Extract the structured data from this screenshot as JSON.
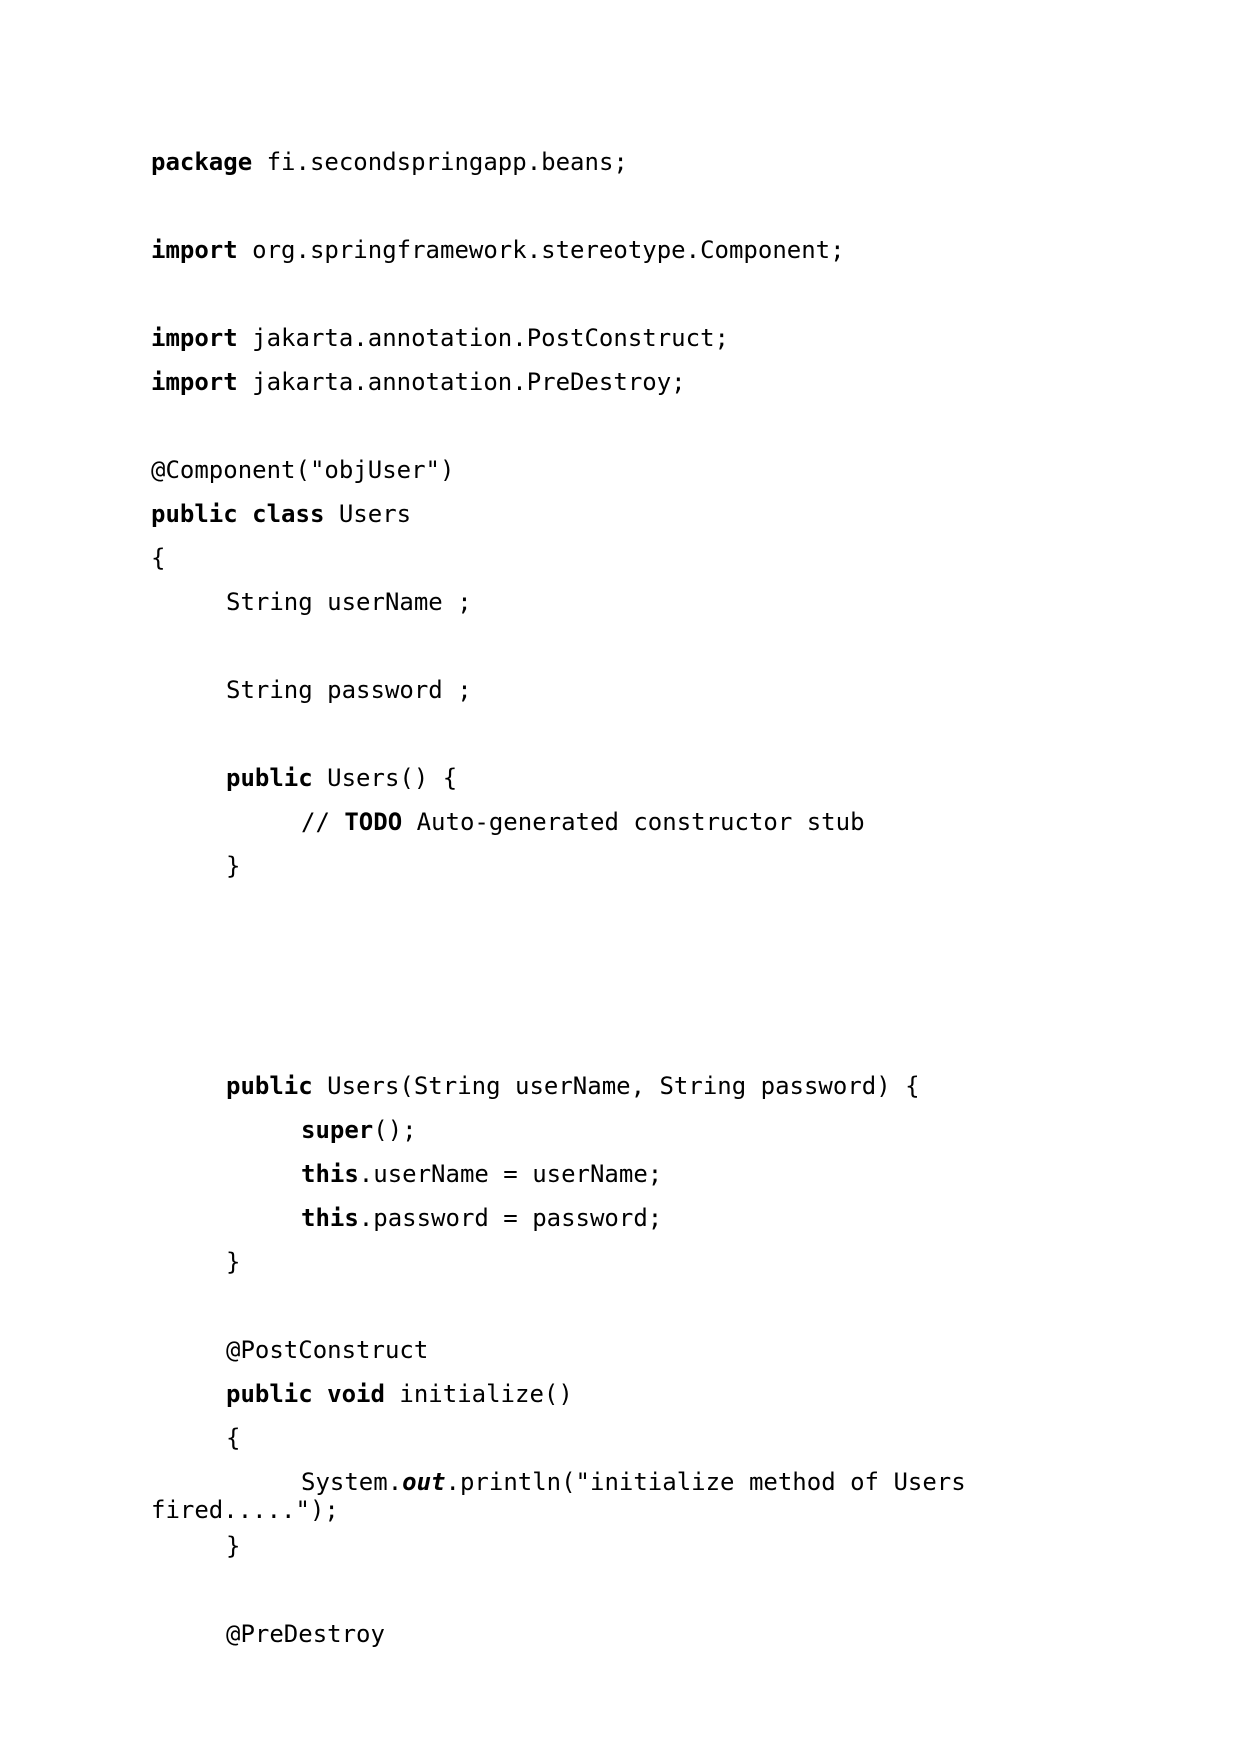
{
  "code": {
    "package_kw": "package",
    "package_name": " fi.secondspringapp.beans;",
    "import_kw": "import",
    "import_component": " org.springframework.stereotype.Component;",
    "import_postconstruct": " jakarta.annotation.PostConstruct;",
    "import_predestroy": " jakarta.annotation.PreDestroy;",
    "component_annotation": "@Component(\"objUser\")",
    "public_kw": "public",
    "class_kw": "class",
    "class_name": " Users",
    "open_brace": "{",
    "close_brace": "}",
    "field_username": "String userName ;",
    "field_password": "String password ;",
    "ctor_default_sig": " Users() {",
    "todo_prefix": "// ",
    "todo_kw": "TODO",
    "todo_text": " Auto-generated constructor stub",
    "ctor_args_sig": " Users(String userName, String password) {",
    "super_kw": "super",
    "super_call": "();",
    "this_kw": "this",
    "assign_username": ".userName = userName;",
    "assign_password": ".password = password;",
    "postconstruct_annotation": "@PostConstruct",
    "void_kw": "void",
    "initialize_sig": " initialize()",
    "println_prefix": "System.",
    "println_out": "out",
    "println_call": ".println(\"initialize method of Users",
    "println_wrap": "fired.....\");",
    "predestroy_annotation": "@PreDestroy"
  }
}
